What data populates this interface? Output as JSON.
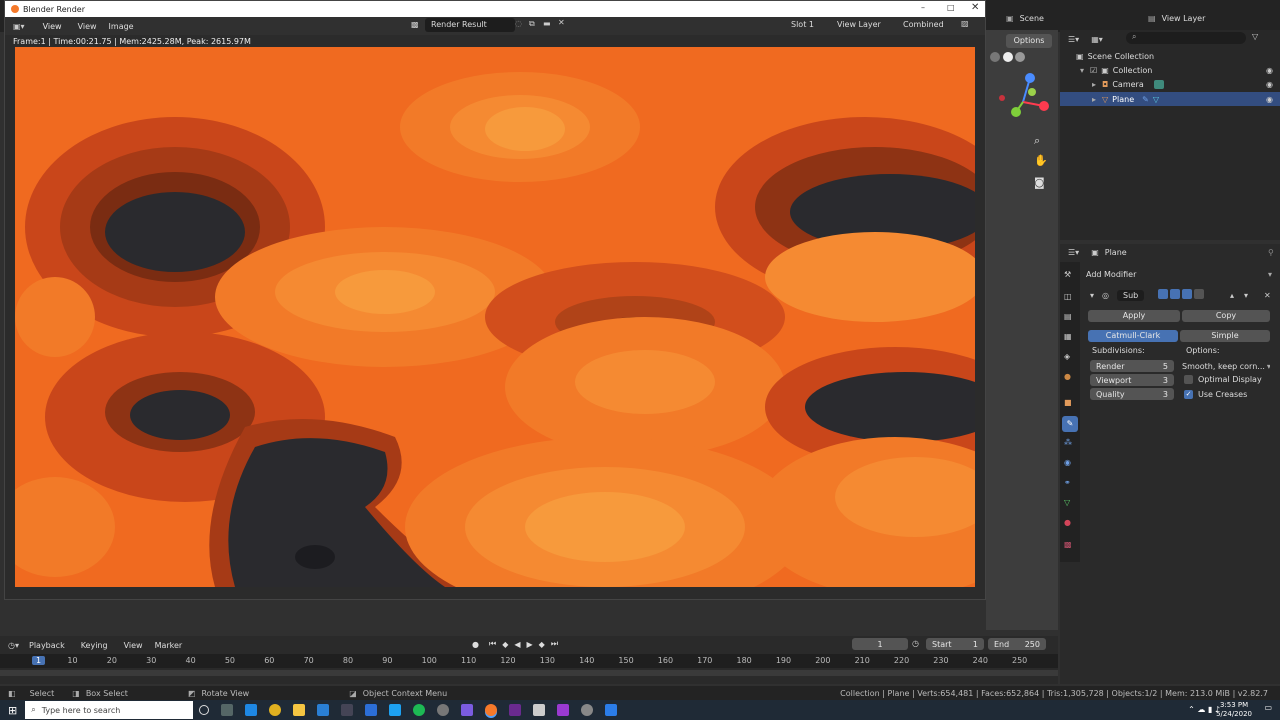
{
  "window": {
    "title": "Blender Render",
    "menu": [
      "View",
      "View",
      "Image"
    ],
    "image_name": "Render Result",
    "slot": "Slot 1",
    "view_layer": "View Layer",
    "pass": "Combined",
    "stats": "Frame:1 | Time:00:21.75 | Mem:2425.28M, Peak: 2615.97M"
  },
  "topbar": {
    "scene": "Scene",
    "view_layer": "View Layer",
    "options": "Options"
  },
  "outliner": {
    "items": [
      {
        "label": "Scene Collection"
      },
      {
        "label": "Collection"
      },
      {
        "label": "Camera"
      },
      {
        "label": "Plane"
      }
    ]
  },
  "properties": {
    "object": "Plane",
    "add_modifier": "Add Modifier",
    "modifier_name": "Sub",
    "apply": "Apply",
    "copy": "Copy",
    "catmull": "Catmull-Clark",
    "simple": "Simple",
    "subdivisions": "Subdivisions:",
    "options": "Options:",
    "render_label": "Render",
    "render_value": "5",
    "viewport_label": "Viewport",
    "viewport_value": "3",
    "quality_label": "Quality",
    "quality_value": "3",
    "uv_smooth": "Smooth, keep corn...",
    "optimal_display": "Optimal Display",
    "use_creases": "Use Creases"
  },
  "timeline": {
    "menus": [
      "Playback",
      "Keying",
      "View",
      "Marker"
    ],
    "current_frame": "1",
    "start_label": "Start",
    "start": "1",
    "end_label": "End",
    "end": "250",
    "ticks": [
      "1",
      "10",
      "20",
      "30",
      "40",
      "50",
      "60",
      "70",
      "80",
      "90",
      "100",
      "110",
      "120",
      "130",
      "140",
      "150",
      "160",
      "170",
      "180",
      "190",
      "200",
      "210",
      "220",
      "230",
      "240",
      "250"
    ]
  },
  "statusbar": {
    "select": "Select",
    "box_select": "Box Select",
    "rotate_view": "Rotate View",
    "context_menu": "Object Context Menu",
    "info": "Collection | Plane | Verts:654,481 | Faces:652,864 | Tris:1,305,728 | Objects:1/2 | Mem: 213.0 MiB | v2.82.7"
  },
  "taskbar": {
    "search_placeholder": "Type here to search",
    "time": "3:53 PM",
    "date": "5/24/2020"
  },
  "colors": {
    "accent": "#4772b3",
    "orange": "#f5741e",
    "dark": "#2a2a2e"
  }
}
